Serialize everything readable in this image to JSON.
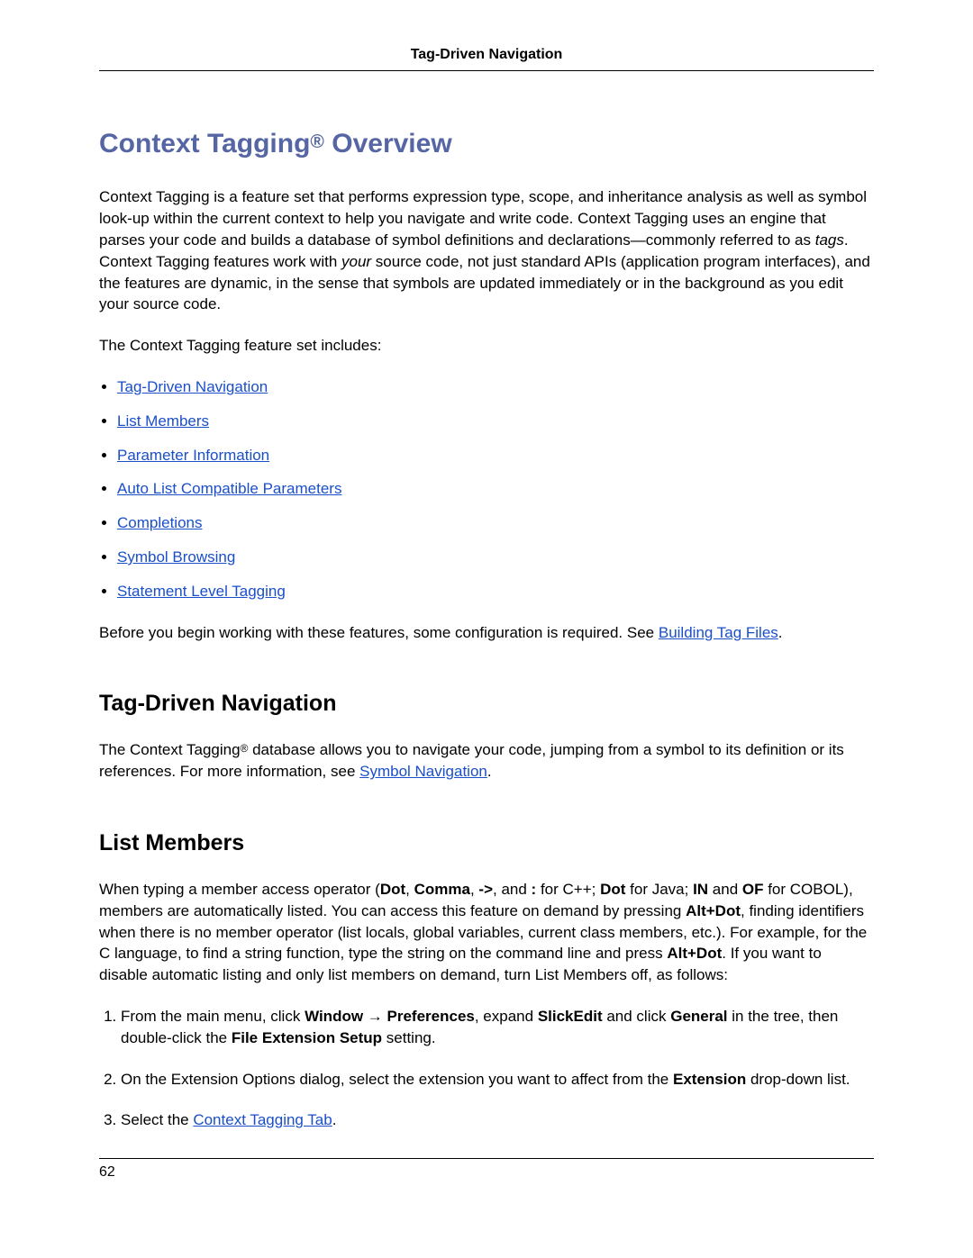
{
  "header": {
    "title": "Tag-Driven Navigation"
  },
  "h1": {
    "pre": "Context Tagging",
    "reg": "®",
    "post": " Overview"
  },
  "intro": {
    "p1a": "Context Tagging is a feature set that performs expression type, scope, and inheritance analysis as well as symbol look-up within the current context to help you navigate and write code. Context Tagging uses an engine that parses your code and builds a database of symbol definitions and declarations—commonly referred to as ",
    "p1_tags": "tags",
    "p1b": ". Context Tagging features work with ",
    "p1_your": "your",
    "p1c": " source code, not just standard APIs (application program interfaces), and the features are dynamic, in the sense that symbols are updated immediately or in the background as you edit your source code.",
    "p2": "The Context Tagging feature set includes:"
  },
  "features": [
    "Tag-Driven Navigation",
    "List Members",
    "Parameter Information",
    "Auto List Compatible Parameters",
    "Completions",
    "Symbol Browsing",
    "Statement Level Tagging"
  ],
  "before": {
    "text": "Before you begin working with these features, some configuration is required. See ",
    "link": "Building Tag Files",
    "tail": "."
  },
  "tdn": {
    "title": "Tag-Driven Navigation",
    "p_a": "The Context Tagging",
    "reg": "®",
    "p_b": " database allows you to navigate your code, jumping from a symbol to its definition or its references. For more information, see ",
    "link": "Symbol Navigation",
    "tail": "."
  },
  "lm": {
    "title": "List Members",
    "p": {
      "a": "When typing a member access operator (",
      "b_dot": "Dot",
      "c1": ", ",
      "b_comma": "Comma",
      "c2": ", ",
      "b_arrow": "->",
      "c3": ", and ",
      "b_colon": ":",
      "c4": " for C++; ",
      "b_dot2": "Dot",
      "c5": " for Java; ",
      "b_in": "IN",
      "c6": " and ",
      "b_of": "OF",
      "c7": " for COBOL), members are automatically listed. You can access this feature on demand by pressing ",
      "b_altdot": "Alt+Dot",
      "c8": ", finding identifiers when there is no member operator (list locals, global variables, current class members, etc.). For example, for the C language, to find a string function, type the string on the command line and press ",
      "b_altdot2": "Alt+Dot",
      "c9": ". If you want to disable automatic listing and only list members on demand, turn List Members off, as follows:"
    },
    "steps": {
      "s1": {
        "a": "From the main menu, click ",
        "b_window": "Window",
        "arrow": " → ",
        "b_pref": "Preferences",
        "b": ", expand ",
        "b_se": "SlickEdit",
        "c": " and click ",
        "b_gen": "General",
        "d": " in the tree, then double-click the ",
        "b_fes": "File Extension Setup",
        "e": " setting."
      },
      "s2": {
        "a": "On the Extension Options dialog, select the extension you want to affect from the ",
        "b_ext": "Extension",
        "b": " drop-down list."
      },
      "s3": {
        "a": "Select the ",
        "link": "Context Tagging Tab",
        "b": "."
      }
    }
  },
  "page": "62"
}
